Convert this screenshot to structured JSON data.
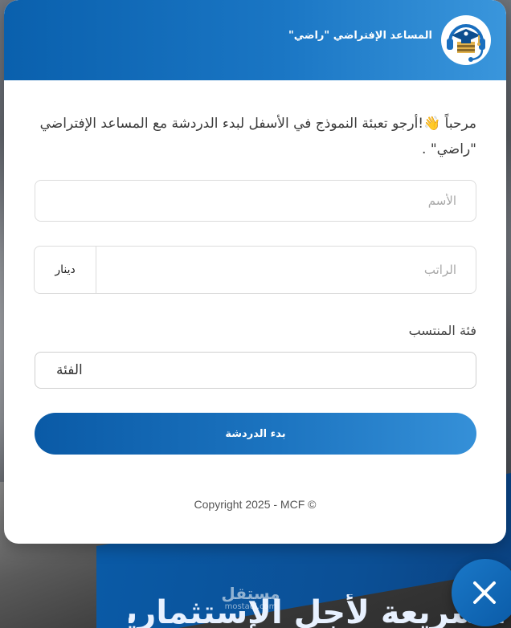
{
  "background": {
    "watermark": {
      "name_ar": "مستقل",
      "domain": "mostaql.com"
    },
    "banner_text": "السريعة لأجل الإستثمارية"
  },
  "header": {
    "title": "المساعد الإفتراضي \"راضي\"",
    "avatar_icon": "graduation-cap-headset-icon"
  },
  "form": {
    "welcome_text": "مرحباً 👋!أرجو تعبئة النموذج في الأسفل لبدء الدردشة مع المساعد الإفتراضي \"راضي\" .",
    "name": {
      "placeholder": "الأسم",
      "value": ""
    },
    "salary": {
      "placeholder": "الراتب",
      "value": "",
      "currency": "دينار"
    },
    "category": {
      "label": "فئة المنتسب",
      "selected": "الفئة"
    },
    "submit_label": "بدء الدردشة"
  },
  "footer": {
    "copyright": "Copyright 2025 - MCF ©"
  },
  "close_button": {
    "icon": "close-icon"
  },
  "colors": {
    "primary": "#0a5aa6",
    "primary_light": "#3a96dc",
    "text": "#3b3b3b",
    "border": "#dcdcdc"
  }
}
